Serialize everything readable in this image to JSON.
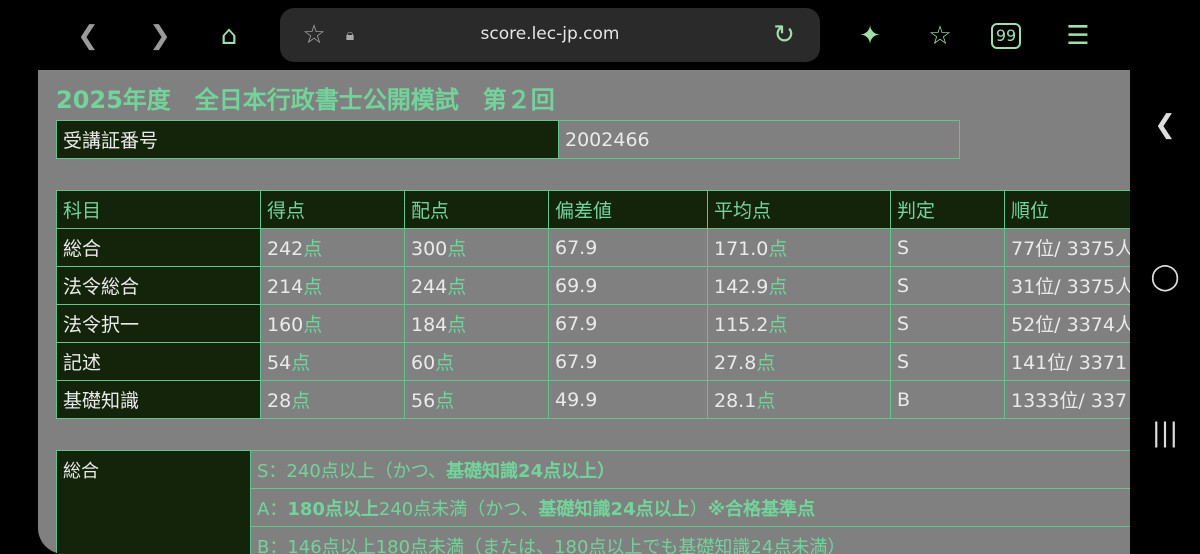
{
  "browser": {
    "url": "score.lec-jp.com"
  },
  "page": {
    "title": "2025年度　全日本行政書士公開模試　第２回",
    "student_id_label": "受講証番号",
    "student_id": "2002466",
    "columns": [
      "科目",
      "得点",
      "配点",
      "偏差値",
      "平均点",
      "判定",
      "順位"
    ],
    "unit": "点",
    "rows": [
      {
        "subject": "総合",
        "score": "242",
        "max": "300",
        "deviation": "67.9",
        "average": "171.0",
        "grade": "S",
        "rank": "77位/ 3375人"
      },
      {
        "subject": "法令総合",
        "score": "214",
        "max": "244",
        "deviation": "69.9",
        "average": "142.9",
        "grade": "S",
        "rank": "31位/ 3375人"
      },
      {
        "subject": "法令択一",
        "score": "160",
        "max": "184",
        "deviation": "67.9",
        "average": "115.2",
        "grade": "S",
        "rank": "52位/ 3374人"
      },
      {
        "subject": "記述",
        "score": "54",
        "max": "60",
        "deviation": "67.9",
        "average": "27.8",
        "grade": "S",
        "rank": "141位/ 3371"
      },
      {
        "subject": "基礎知識",
        "score": "28",
        "max": "56",
        "deviation": "49.9",
        "average": "28.1",
        "grade": "B",
        "rank": "1333位/ 337"
      }
    ],
    "criteria": {
      "label": "総合",
      "s": {
        "a": "S：240点以上（かつ、",
        "b": "基礎知識24点以上）"
      },
      "a": {
        "a": "A：",
        "b": "180点以上",
        "c": "240点未満（かつ、",
        "d": "基礎知識24点以上",
        "e": "）",
        "f": "※合格基準点"
      },
      "b": "B：146点以上180点未満（または、180点以上でも基礎知識24点未満）"
    }
  }
}
